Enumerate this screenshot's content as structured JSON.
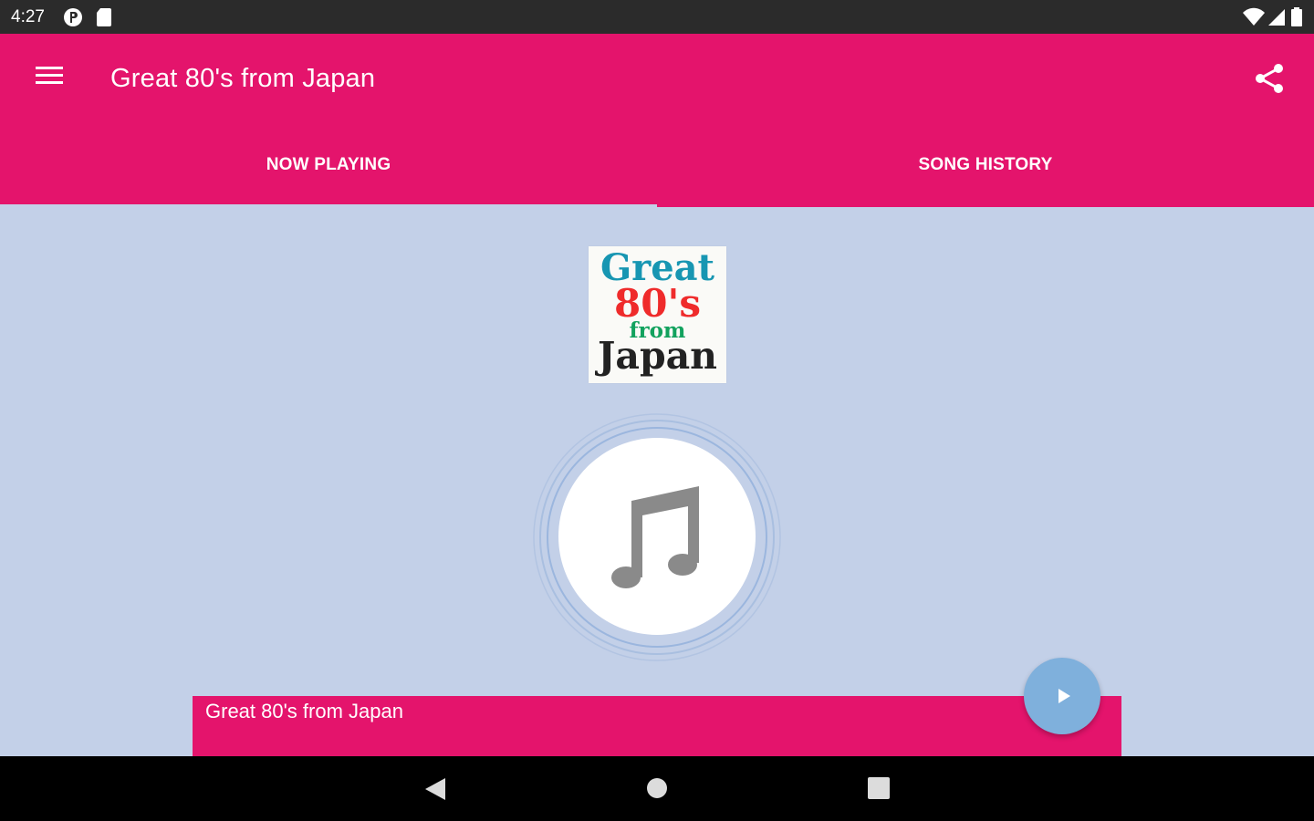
{
  "status_bar": {
    "time": "4:27",
    "left_icons": [
      "notification-p-icon",
      "sd-card-icon"
    ],
    "right_icons": [
      "wifi-icon",
      "cell-signal-icon",
      "battery-icon"
    ]
  },
  "app_bar": {
    "title": "Great 80's from Japan",
    "menu_icon": "hamburger-menu-icon",
    "share_icon": "share-icon",
    "color": "#e4146c"
  },
  "tabs": [
    {
      "label": "NOW PLAYING",
      "selected": true
    },
    {
      "label": "SONG HISTORY",
      "selected": false
    }
  ],
  "station_logo": {
    "line1": "Great",
    "line2": "80's",
    "line3": "from",
    "line4": "Japan"
  },
  "artwork": {
    "icon": "music-note-icon"
  },
  "player_bar": {
    "title": "Great 80's from Japan",
    "play_icon": "play-icon",
    "fab_color": "#7fb0dc"
  },
  "nav_bar": {
    "icons": [
      "back-icon",
      "home-icon",
      "recents-icon"
    ]
  },
  "colors": {
    "accent": "#e4146c",
    "background": "#c3d0e8"
  }
}
